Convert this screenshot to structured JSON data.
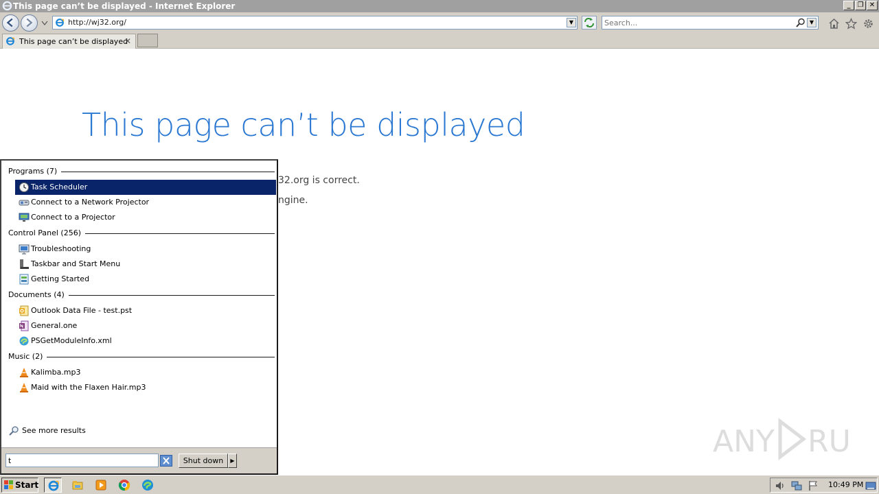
{
  "window": {
    "title": "This page can’t be displayed - Internet Explorer"
  },
  "toolbar": {
    "address_url": "http://wj32.org/",
    "search_placeholder": "Search..."
  },
  "tabs": [
    {
      "label": "This page can’t be displayed",
      "close": "✕"
    }
  ],
  "page": {
    "heading": "This page can’t be displayed",
    "line1_visible": "32.org is correct.",
    "line2_visible": "ngine."
  },
  "start_menu": {
    "groups": [
      {
        "label": "Programs (7)",
        "items": [
          {
            "label": "Task Scheduler",
            "icon": "clock-icon",
            "selected": true
          },
          {
            "label": "Connect to a Network Projector",
            "icon": "network-projector-icon"
          },
          {
            "label": "Connect to a Projector",
            "icon": "projector-icon"
          }
        ]
      },
      {
        "label": "Control Panel (256)",
        "items": [
          {
            "label": "Troubleshooting",
            "icon": "troubleshooting-icon"
          },
          {
            "label": "Taskbar and Start Menu",
            "icon": "taskbar-icon"
          },
          {
            "label": "Getting Started",
            "icon": "getting-started-icon"
          }
        ]
      },
      {
        "label": "Documents (4)",
        "items": [
          {
            "label": "Outlook Data File - test.pst",
            "icon": "outlook-icon"
          },
          {
            "label": "General.one",
            "icon": "onenote-icon"
          },
          {
            "label": "PSGetModuleInfo.xml",
            "icon": "edge-file-icon"
          }
        ]
      },
      {
        "label": "Music (2)",
        "items": [
          {
            "label": "Kalimba.mp3",
            "icon": "vlc-icon"
          },
          {
            "label": "Maid with the Flaxen Hair.mp3",
            "icon": "vlc-icon"
          }
        ]
      }
    ],
    "see_more": "See more results",
    "search_value": "t",
    "shutdown_label": "Shut down"
  },
  "taskbar": {
    "start_label": "Start",
    "clock": "10:49 PM",
    "pinned": [
      "ie-icon",
      "explorer-icon",
      "media-player-icon",
      "chrome-icon",
      "edge-icon"
    ]
  },
  "colors": {
    "heading_blue": "#2b78d3",
    "selection": "#0a246a",
    "chrome_gray": "#d4d0c8"
  }
}
